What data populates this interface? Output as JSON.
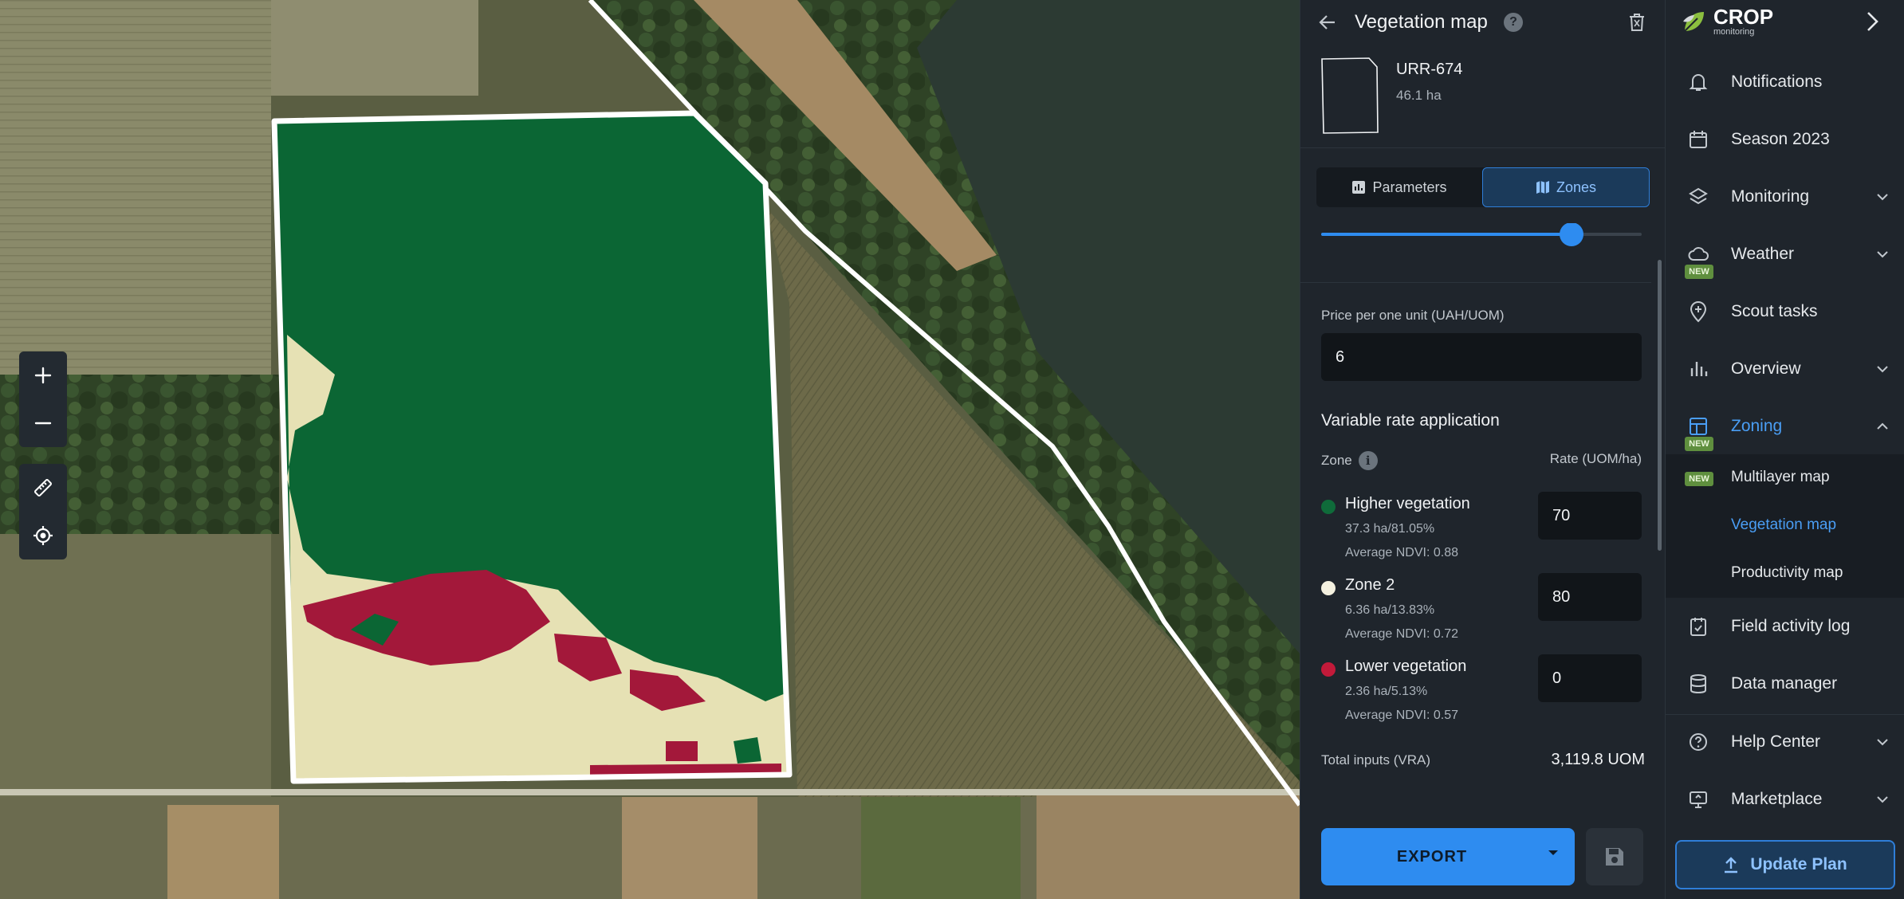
{
  "panel": {
    "title": "Vegetation map",
    "help_glyph": "?",
    "field": {
      "name": "URR-674",
      "area": "46.1 ha"
    },
    "tabs": [
      {
        "label": "Parameters",
        "icon": "bar-chart-icon"
      },
      {
        "label": "Zones",
        "icon": "map-icon",
        "active": true
      }
    ],
    "slider_level": 0.78,
    "price_label": "Price per one unit (UAH/UOM)",
    "price_value": "6",
    "vra_title": "Variable rate application",
    "zone_header": "Zone",
    "info_glyph": "i",
    "rate_header": "Rate (UOM/ha)",
    "zones": [
      {
        "name": "Higher vegetation",
        "stats": "37.3 ha/81.05%",
        "ndvi": "Average NDVI: 0.88",
        "rate": "70",
        "color": "#0f6b3a"
      },
      {
        "name": "Zone 2",
        "stats": "6.36 ha/13.83%",
        "ndvi": "Average NDVI: 0.72",
        "rate": "80",
        "color": "#f4f1e0"
      },
      {
        "name": "Lower vegetation",
        "stats": "2.36 ha/5.13%",
        "ndvi": "Average NDVI: 0.57",
        "rate": "0",
        "color": "#c21a3a"
      }
    ],
    "total_label": "Total inputs (VRA)",
    "total_value": "3,119.8  UOM",
    "export_label": "EXPORT"
  },
  "sidebar": {
    "logo_title": "CROP",
    "logo_subtitle": "monitoring",
    "new_badge": "NEW",
    "items": [
      {
        "label": "Notifications",
        "icon": "bell-icon"
      },
      {
        "label": "Season 2023",
        "icon": "calendar-icon"
      },
      {
        "label": "Monitoring",
        "icon": "layers-icon",
        "expandable": true
      },
      {
        "label": "Weather",
        "icon": "cloud-icon",
        "expandable": true,
        "badge": "NEW"
      },
      {
        "label": "Scout tasks",
        "icon": "pin-icon"
      },
      {
        "label": "Overview",
        "icon": "bar-chart-icon",
        "expandable": true
      },
      {
        "label": "Zoning",
        "icon": "layout-icon",
        "expanded": true,
        "active": true,
        "badge": "NEW"
      },
      {
        "label": "Field activity log",
        "icon": "clipboard-icon"
      },
      {
        "label": "Data manager",
        "icon": "database-icon"
      },
      {
        "label": "Help Center",
        "icon": "help-icon",
        "expandable": true
      },
      {
        "label": "Marketplace",
        "icon": "monitor-icon",
        "expandable": true
      }
    ],
    "zoning_sub": [
      {
        "label": "Multilayer map",
        "badge": "NEW"
      },
      {
        "label": "Vegetation map",
        "active": true
      },
      {
        "label": "Productivity map"
      }
    ],
    "update_plan": "Update Plan"
  },
  "colors": {
    "accent": "#2e8cf0",
    "high_veg": "#0f6b3a",
    "mid_veg": "#e6e1b4",
    "low_veg": "#a3183a"
  }
}
